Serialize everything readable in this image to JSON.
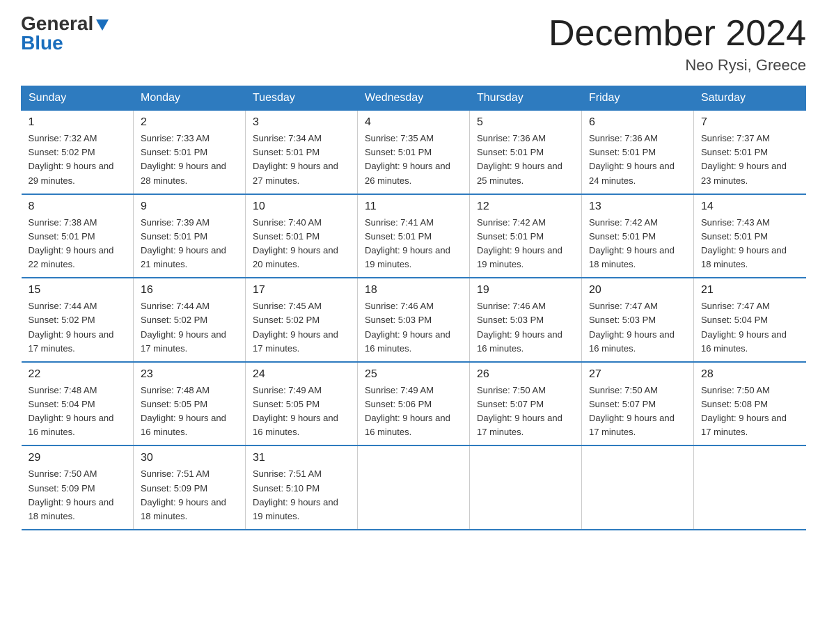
{
  "logo": {
    "general": "General",
    "blue": "Blue"
  },
  "title": "December 2024",
  "subtitle": "Neo Rysi, Greece",
  "days_of_week": [
    "Sunday",
    "Monday",
    "Tuesday",
    "Wednesday",
    "Thursday",
    "Friday",
    "Saturday"
  ],
  "weeks": [
    [
      {
        "day": "1",
        "sunrise": "7:32 AM",
        "sunset": "5:02 PM",
        "daylight": "9 hours and 29 minutes."
      },
      {
        "day": "2",
        "sunrise": "7:33 AM",
        "sunset": "5:01 PM",
        "daylight": "9 hours and 28 minutes."
      },
      {
        "day": "3",
        "sunrise": "7:34 AM",
        "sunset": "5:01 PM",
        "daylight": "9 hours and 27 minutes."
      },
      {
        "day": "4",
        "sunrise": "7:35 AM",
        "sunset": "5:01 PM",
        "daylight": "9 hours and 26 minutes."
      },
      {
        "day": "5",
        "sunrise": "7:36 AM",
        "sunset": "5:01 PM",
        "daylight": "9 hours and 25 minutes."
      },
      {
        "day": "6",
        "sunrise": "7:36 AM",
        "sunset": "5:01 PM",
        "daylight": "9 hours and 24 minutes."
      },
      {
        "day": "7",
        "sunrise": "7:37 AM",
        "sunset": "5:01 PM",
        "daylight": "9 hours and 23 minutes."
      }
    ],
    [
      {
        "day": "8",
        "sunrise": "7:38 AM",
        "sunset": "5:01 PM",
        "daylight": "9 hours and 22 minutes."
      },
      {
        "day": "9",
        "sunrise": "7:39 AM",
        "sunset": "5:01 PM",
        "daylight": "9 hours and 21 minutes."
      },
      {
        "day": "10",
        "sunrise": "7:40 AM",
        "sunset": "5:01 PM",
        "daylight": "9 hours and 20 minutes."
      },
      {
        "day": "11",
        "sunrise": "7:41 AM",
        "sunset": "5:01 PM",
        "daylight": "9 hours and 19 minutes."
      },
      {
        "day": "12",
        "sunrise": "7:42 AM",
        "sunset": "5:01 PM",
        "daylight": "9 hours and 19 minutes."
      },
      {
        "day": "13",
        "sunrise": "7:42 AM",
        "sunset": "5:01 PM",
        "daylight": "9 hours and 18 minutes."
      },
      {
        "day": "14",
        "sunrise": "7:43 AM",
        "sunset": "5:01 PM",
        "daylight": "9 hours and 18 minutes."
      }
    ],
    [
      {
        "day": "15",
        "sunrise": "7:44 AM",
        "sunset": "5:02 PM",
        "daylight": "9 hours and 17 minutes."
      },
      {
        "day": "16",
        "sunrise": "7:44 AM",
        "sunset": "5:02 PM",
        "daylight": "9 hours and 17 minutes."
      },
      {
        "day": "17",
        "sunrise": "7:45 AM",
        "sunset": "5:02 PM",
        "daylight": "9 hours and 17 minutes."
      },
      {
        "day": "18",
        "sunrise": "7:46 AM",
        "sunset": "5:03 PM",
        "daylight": "9 hours and 16 minutes."
      },
      {
        "day": "19",
        "sunrise": "7:46 AM",
        "sunset": "5:03 PM",
        "daylight": "9 hours and 16 minutes."
      },
      {
        "day": "20",
        "sunrise": "7:47 AM",
        "sunset": "5:03 PM",
        "daylight": "9 hours and 16 minutes."
      },
      {
        "day": "21",
        "sunrise": "7:47 AM",
        "sunset": "5:04 PM",
        "daylight": "9 hours and 16 minutes."
      }
    ],
    [
      {
        "day": "22",
        "sunrise": "7:48 AM",
        "sunset": "5:04 PM",
        "daylight": "9 hours and 16 minutes."
      },
      {
        "day": "23",
        "sunrise": "7:48 AM",
        "sunset": "5:05 PM",
        "daylight": "9 hours and 16 minutes."
      },
      {
        "day": "24",
        "sunrise": "7:49 AM",
        "sunset": "5:05 PM",
        "daylight": "9 hours and 16 minutes."
      },
      {
        "day": "25",
        "sunrise": "7:49 AM",
        "sunset": "5:06 PM",
        "daylight": "9 hours and 16 minutes."
      },
      {
        "day": "26",
        "sunrise": "7:50 AM",
        "sunset": "5:07 PM",
        "daylight": "9 hours and 17 minutes."
      },
      {
        "day": "27",
        "sunrise": "7:50 AM",
        "sunset": "5:07 PM",
        "daylight": "9 hours and 17 minutes."
      },
      {
        "day": "28",
        "sunrise": "7:50 AM",
        "sunset": "5:08 PM",
        "daylight": "9 hours and 17 minutes."
      }
    ],
    [
      {
        "day": "29",
        "sunrise": "7:50 AM",
        "sunset": "5:09 PM",
        "daylight": "9 hours and 18 minutes."
      },
      {
        "day": "30",
        "sunrise": "7:51 AM",
        "sunset": "5:09 PM",
        "daylight": "9 hours and 18 minutes."
      },
      {
        "day": "31",
        "sunrise": "7:51 AM",
        "sunset": "5:10 PM",
        "daylight": "9 hours and 19 minutes."
      },
      null,
      null,
      null,
      null
    ]
  ]
}
